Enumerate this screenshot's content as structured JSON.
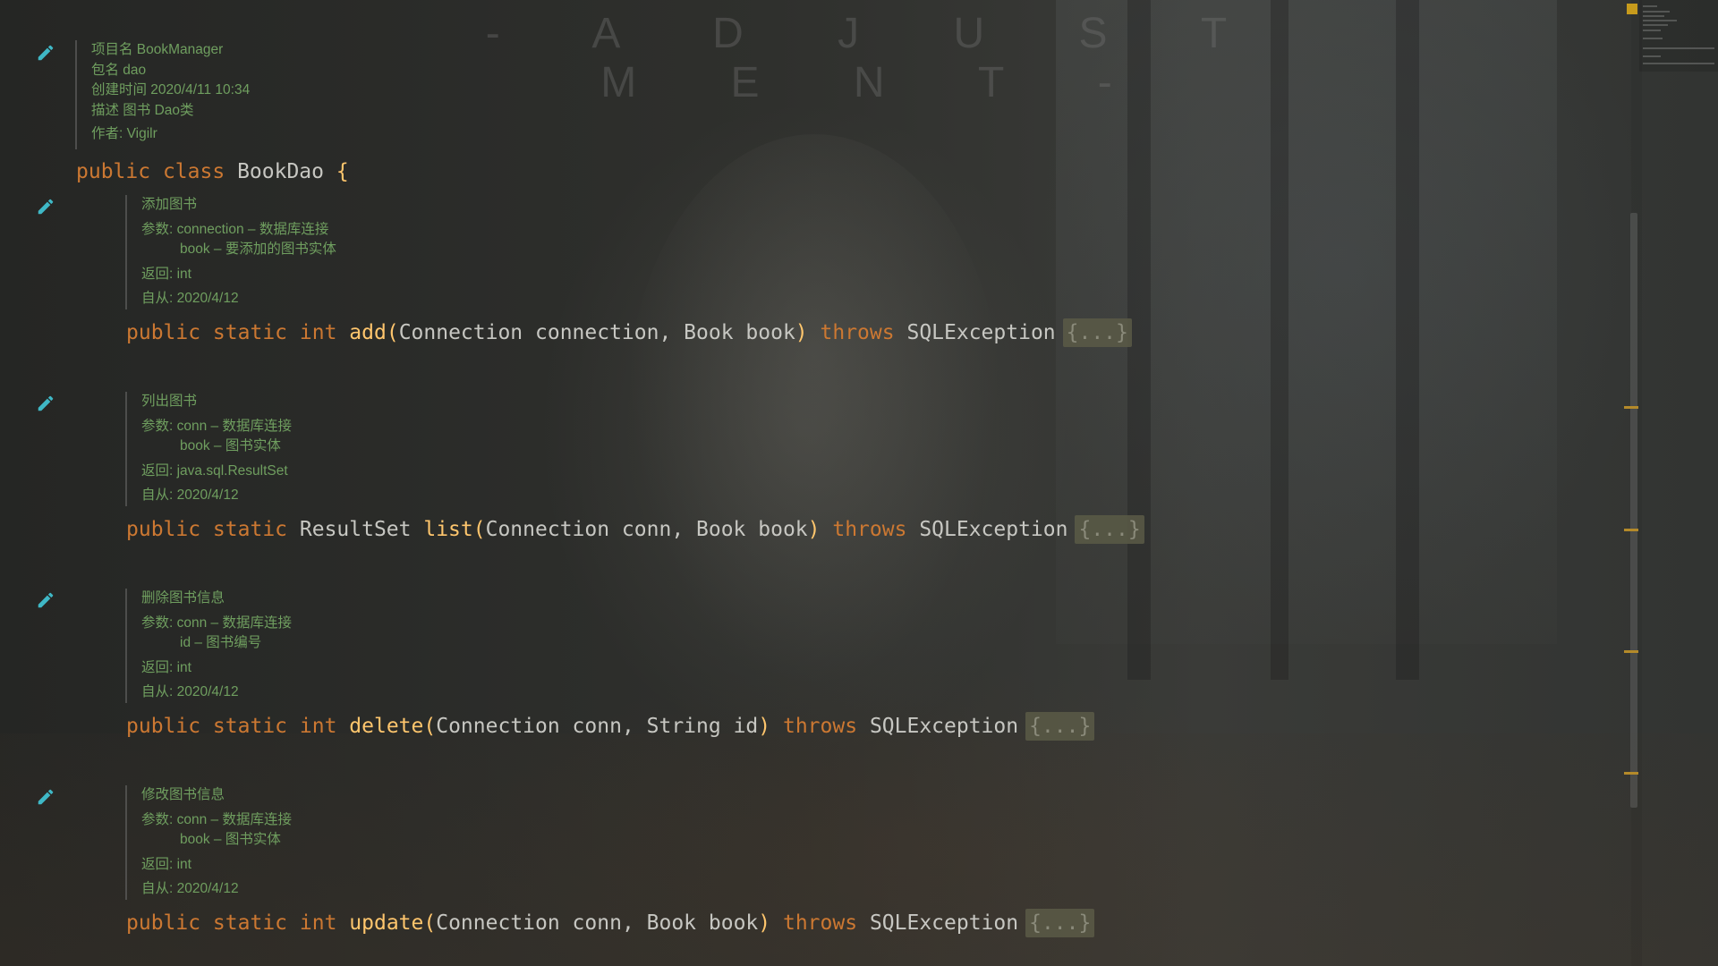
{
  "watermark": "- A D J U S T M E N T -",
  "colors": {
    "keyword": "#cc7832",
    "function": "#ffc66d",
    "identifier": "#c7c7c2",
    "doc_comment": "#6f9e5f",
    "pencil": "#3fb8c6",
    "scroll_marker": "#b48a2a"
  },
  "file_header": {
    "project": "项目名 BookManager",
    "package": "包名 dao",
    "created": "创建时间 2020/4/11 10:34",
    "description": "描述 图书 Dao类",
    "author": "作者: Vigilr"
  },
  "class_decl": {
    "kw_public": "public",
    "kw_class": "class",
    "name": "BookDao",
    "brace": "{"
  },
  "methods": [
    {
      "doc": {
        "title": "添加图书",
        "param1": "参数: connection – 数据库连接",
        "param2": "book – 要添加的图书实体",
        "returns": "返回: int",
        "since": "自从: 2020/4/12"
      },
      "sig": {
        "mods": "public static",
        "ret": "int",
        "name": "add",
        "open": "(",
        "params": "Connection connection, Book book",
        "close": ")",
        "throws": "throws",
        "exc": "SQLException",
        "fold": "{...}"
      }
    },
    {
      "doc": {
        "title": "列出图书",
        "param1": "参数: conn – 数据库连接",
        "param2": "book – 图书实体",
        "returns": "返回: java.sql.ResultSet",
        "since": "自从: 2020/4/12"
      },
      "sig": {
        "mods": "public static",
        "ret": "ResultSet",
        "name": "list",
        "open": "(",
        "params": "Connection conn, Book book",
        "close": ")",
        "throws": "throws",
        "exc": "SQLException",
        "fold": "{...}"
      }
    },
    {
      "doc": {
        "title": "删除图书信息",
        "param1": "参数: conn – 数据库连接",
        "param2": "id – 图书编号",
        "returns": "返回: int",
        "since": "自从: 2020/4/12"
      },
      "sig": {
        "mods": "public static",
        "ret": "int",
        "name": "delete",
        "open": "(",
        "params": "Connection conn, String id",
        "close": ")",
        "throws": "throws",
        "exc": "SQLException",
        "fold": "{...}"
      }
    },
    {
      "doc": {
        "title": "修改图书信息",
        "param1": "参数: conn – 数据库连接",
        "param2": "book – 图书实体",
        "returns": "返回: int",
        "since": "自从: 2020/4/12"
      },
      "sig": {
        "mods": "public static",
        "ret": "int",
        "name": "update",
        "open": "(",
        "params": "Connection conn, Book book",
        "close": ")",
        "throws": "throws",
        "exc": "SQLException",
        "fold": "{...}"
      }
    }
  ]
}
